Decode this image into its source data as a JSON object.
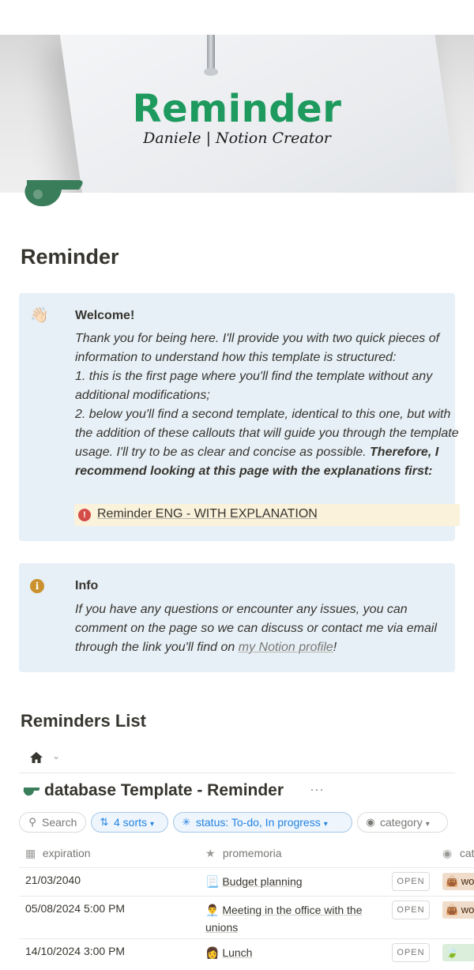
{
  "cover": {
    "title": "Reminder",
    "subtitle": "Daniele | Notion Creator"
  },
  "page": {
    "title": "Reminder",
    "icon": "whistle-icon"
  },
  "callout_welcome": {
    "icon": "waving-hand-icon",
    "title": "Welcome!",
    "line1": "Thank you for being here. I'll provide you with two quick pieces of information to understand how this template is structured:",
    "line2": "1. this is the first page where you'll find the template without any additional modifications;",
    "line3": "2. below you'll find a second template, identical to this one, but with the addition of these callouts that will guide you through the template usage. I'll try to be as clear and concise as possible. ",
    "line3_bold": "Therefore, I recommend looking at this page with the explanations first:",
    "link_label": "Reminder ENG - WITH EXPLANATION"
  },
  "callout_info": {
    "icon": "info-icon",
    "title": "Info",
    "body": "If you have any questions or encounter any issues, you can comment on the page so we can discuss or contact me via email through the link you'll find on ",
    "link": "my Notion profile",
    "end": "!"
  },
  "section": {
    "title": "Reminders List"
  },
  "database": {
    "title": "database Template - Reminder",
    "more": "···",
    "filters": {
      "search": "Search",
      "sorts": "4 sorts",
      "status": "status: To-do, In progress",
      "category": "category"
    },
    "columns": {
      "expiration": "expiration",
      "promemoria": "promemoria",
      "category": "cat"
    },
    "open_label": "OPEN",
    "rows": [
      {
        "date": "21/03/2040",
        "emoji": "📃",
        "name": "Budget planning",
        "tag": "👜 wo"
      },
      {
        "date": "05/08/2024 5:00 PM",
        "emoji": "👨‍💼",
        "name": "Meeting in the office with the unions",
        "tag": "👜 wo"
      },
      {
        "date": "14/10/2024 3:00 PM",
        "emoji": "👩",
        "name": "Lunch",
        "tag": "🍃"
      }
    ]
  },
  "colors": {
    "callout_bg": "#e7f0f7",
    "link_bg": "#fbf2dc",
    "accent_blue": "#2383e2",
    "cover_green": "#1e9a5e"
  }
}
